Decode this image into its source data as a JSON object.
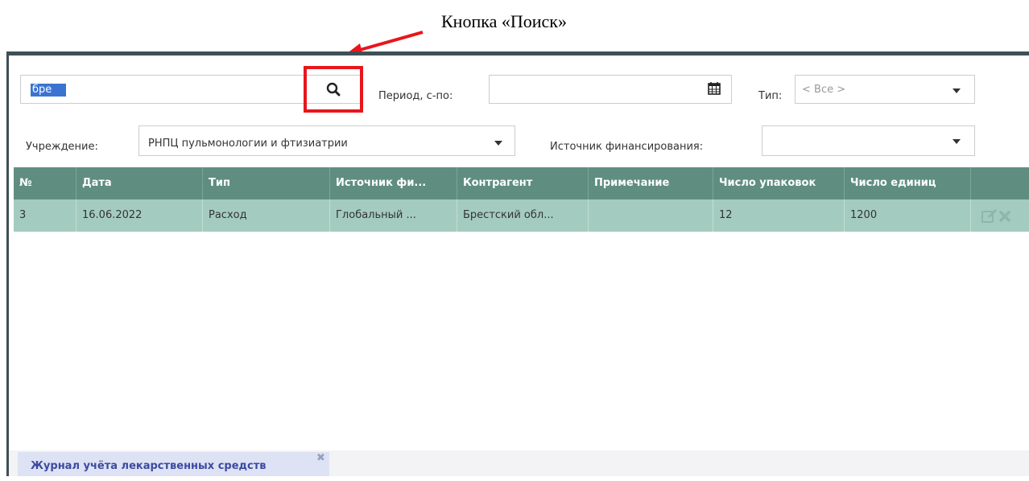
{
  "annotation": {
    "caption": "Кнопка «Поиск»",
    "highlight_color": "#e8161c"
  },
  "filters": {
    "search_value": "бре",
    "search_icon": "search-icon",
    "period_label": "Период, с-по:",
    "period_value": "",
    "calendar_icon": "calendar-icon",
    "type_label": "Тип:",
    "type_value": "< Все >",
    "institution_label": "Учреждение:",
    "institution_value": "РНПЦ пульмонологии и фтизиатрии",
    "funding_label": "Источник финансирования:",
    "funding_value": ""
  },
  "grid": {
    "columns": [
      "№",
      "Дата",
      "Тип",
      "Источник фи...",
      "Контрагент",
      "Примечание",
      "Число упаковок",
      "Число единиц"
    ],
    "rows": [
      {
        "cells": [
          "3",
          "16.06.2022",
          "Расход",
          "Глобальный ...",
          "Брестский обл...",
          "",
          "12",
          "1200"
        ],
        "actions": [
          "edit-icon",
          "delete-icon"
        ]
      }
    ],
    "header_color": "#5f8e80",
    "selected_row_color": "#a4cbbf"
  },
  "tabs": [
    {
      "label": "Журнал учёта лекарственных средств",
      "close_icon": "close-icon"
    }
  ]
}
